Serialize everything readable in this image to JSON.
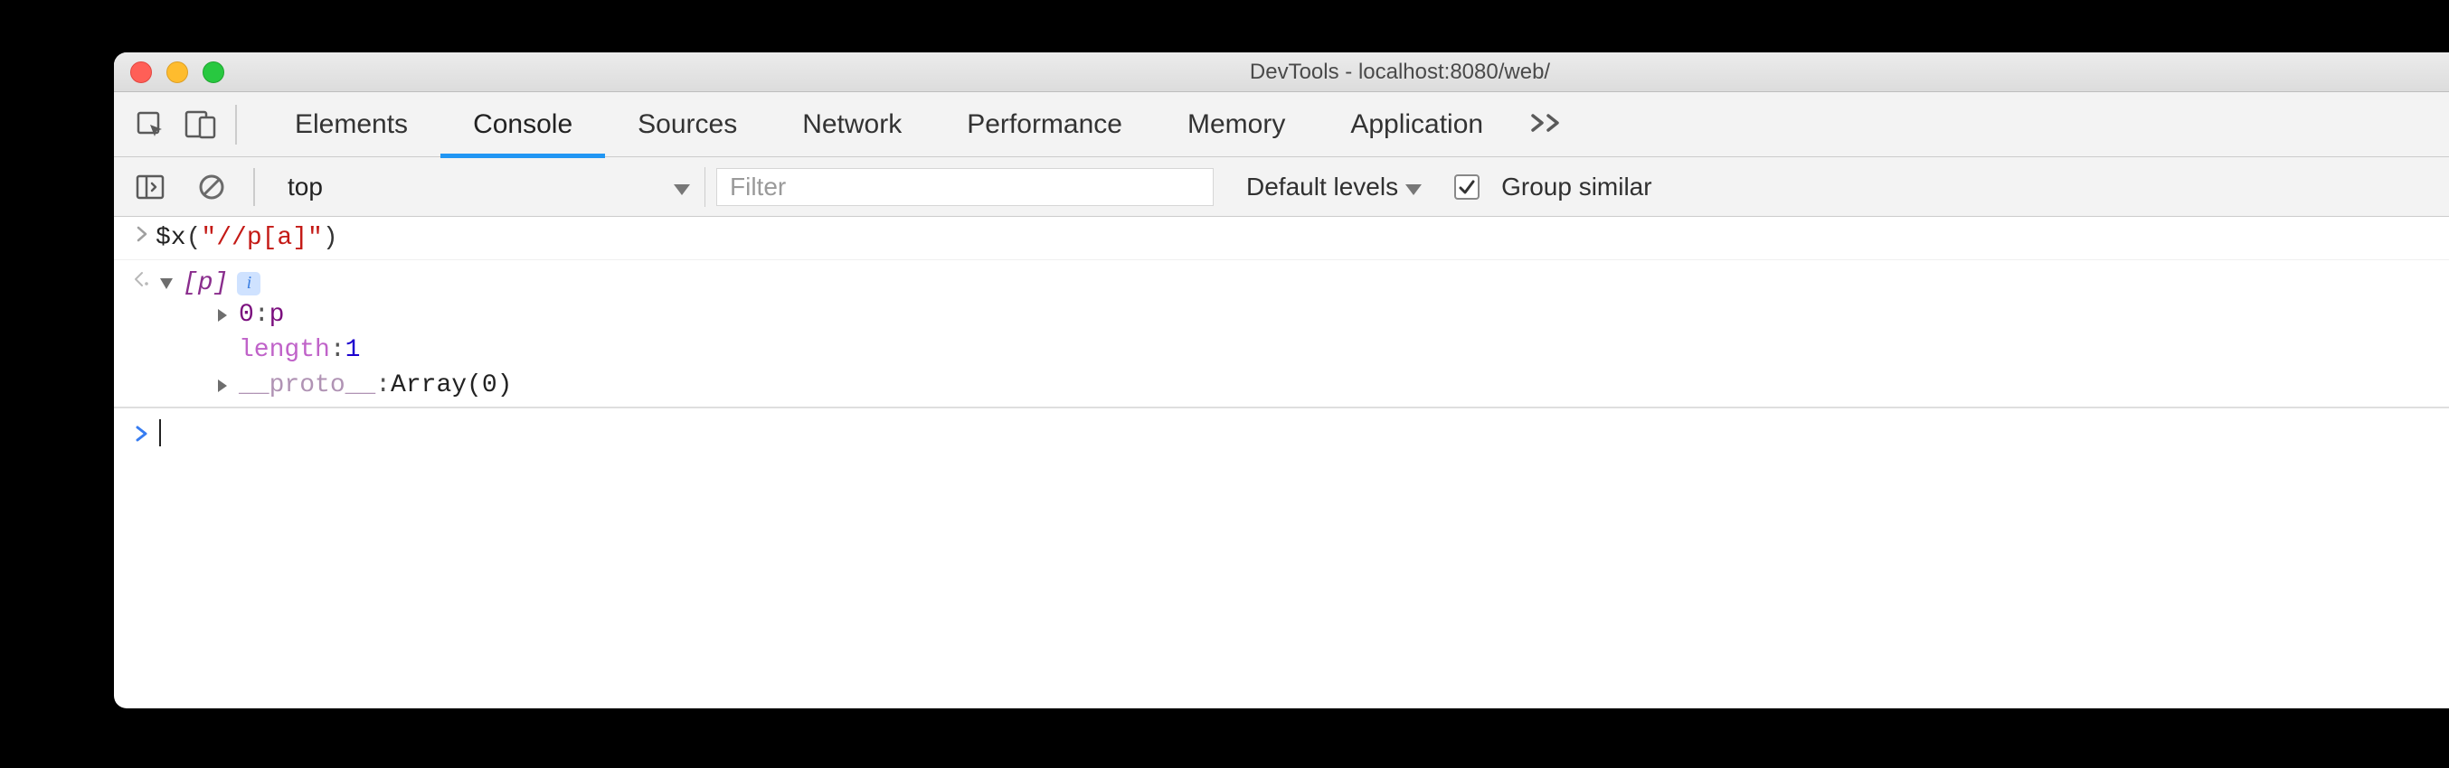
{
  "window": {
    "title": "DevTools - localhost:8080/web/"
  },
  "tabs": {
    "items": [
      {
        "label": "Elements"
      },
      {
        "label": "Console"
      },
      {
        "label": "Sources"
      },
      {
        "label": "Network"
      },
      {
        "label": "Performance"
      },
      {
        "label": "Memory"
      },
      {
        "label": "Application"
      }
    ],
    "active_index": 1
  },
  "toolbar": {
    "context": "top",
    "filter_placeholder": "Filter",
    "levels_label": "Default levels",
    "group_similar_label": "Group similar",
    "group_similar_checked": true
  },
  "console": {
    "input_fn": "$x",
    "input_arg": "\"//p[a]\"",
    "output_summary": "[p]",
    "tree": {
      "idx_key": "0",
      "idx_val": "p",
      "length_key": "length",
      "length_val": "1",
      "proto_key": "__proto__",
      "proto_val": "Array(0)"
    }
  }
}
